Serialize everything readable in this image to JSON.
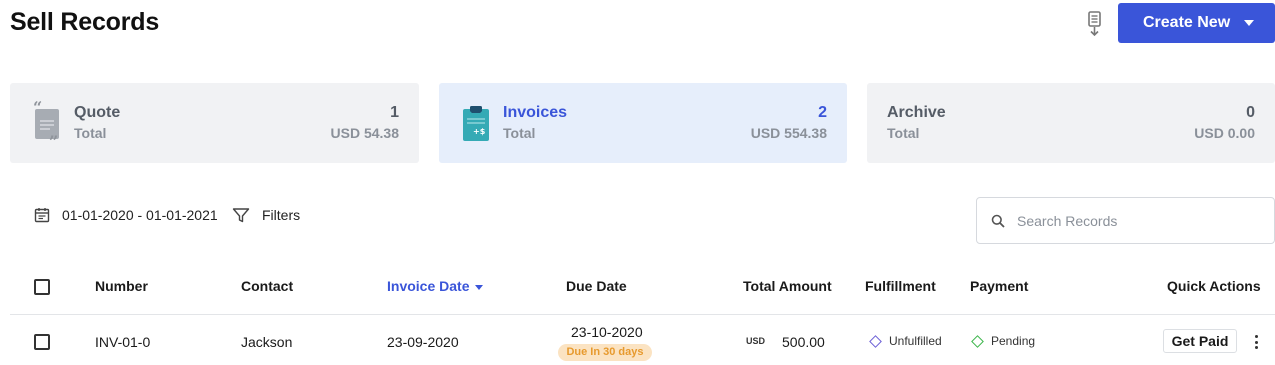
{
  "header": {
    "title": "Sell Records",
    "create_label": "Create New"
  },
  "cards": [
    {
      "label": "Quote",
      "sub": "Total",
      "count": "1",
      "amount": "USD 54.38",
      "icon": "quote-doc-icon"
    },
    {
      "label": "Invoices",
      "sub": "Total",
      "count": "2",
      "amount": "USD 554.38",
      "icon": "invoice-clipboard-icon"
    },
    {
      "label": "Archive",
      "sub": "Total",
      "count": "0",
      "amount": "USD 0.00"
    }
  ],
  "filters": {
    "date_range": "01-01-2020 - 01-01-2021",
    "filters_label": "Filters",
    "search_placeholder": "Search Records"
  },
  "table": {
    "columns": [
      "Number",
      "Contact",
      "Invoice Date",
      "Due Date",
      "Total Amount",
      "Fulfillment",
      "Payment",
      "Quick Actions"
    ],
    "sorted_column": "Invoice Date",
    "rows": [
      {
        "number": "INV-01-0",
        "contact": "Jackson",
        "invoice_date": "23-09-2020",
        "due_date": "23-10-2020",
        "due_badge": "Due In 30 days",
        "currency": "USD",
        "amount": "500.00",
        "fulfillment": "Unfulfilled",
        "payment": "Pending",
        "action": "Get Paid"
      }
    ]
  },
  "colors": {
    "accent": "#3a55d9",
    "unfulfilled": "#6b5fd6",
    "pending": "#3bb54a",
    "due_badge_bg": "#fbe3c2",
    "due_badge_text": "#e79a2e"
  }
}
